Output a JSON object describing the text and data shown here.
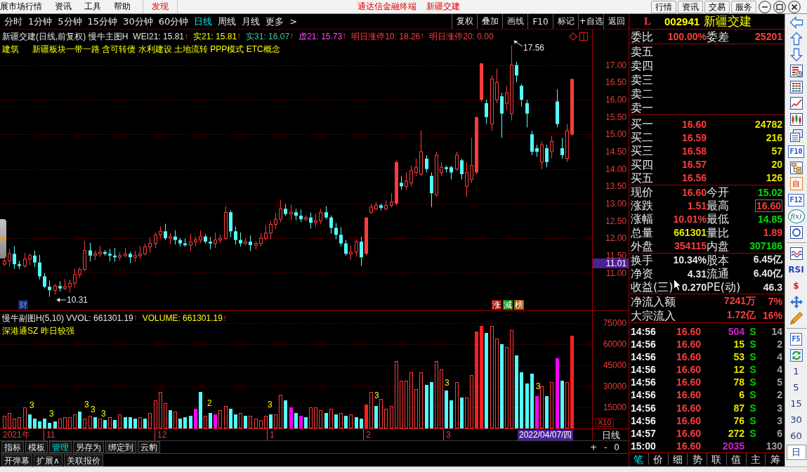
{
  "title_bar": {
    "menu": [
      {
        "label": "展市场行情",
        "emphasized": false
      },
      {
        "label": "资讯",
        "emphasized": false
      },
      {
        "label": "工具",
        "emphasized": false
      },
      {
        "label": "帮助",
        "emphasized": false
      },
      {
        "label": "发现",
        "emphasized": true
      }
    ],
    "app_title": "通达信金融终端",
    "stock_title": "新疆交建",
    "buttons": [
      "行情",
      "资讯",
      "交易",
      "服务"
    ]
  },
  "period_bar": {
    "periods": [
      {
        "label": "分时",
        "selected": false
      },
      {
        "label": "1分钟",
        "selected": false
      },
      {
        "label": "5分钟",
        "selected": false
      },
      {
        "label": "15分钟",
        "selected": false
      },
      {
        "label": "30分钟",
        "selected": false
      },
      {
        "label": "60分钟",
        "selected": false
      },
      {
        "label": "日线",
        "selected": true
      },
      {
        "label": "周线",
        "selected": false
      },
      {
        "label": "月线",
        "selected": false
      },
      {
        "label": "更多",
        "selected": false
      }
    ],
    "more_arrow": ">",
    "actions": [
      "复权",
      "叠加",
      "画线",
      "F10",
      "标记",
      "+自选",
      "返回"
    ]
  },
  "main_chart": {
    "legend": [
      {
        "text": "新疆交建(日线,前复权) 慢牛主图H",
        "color": "#e6e6e6"
      },
      {
        "text": "WEI21: 15.81",
        "color": "#e6e6e6",
        "trend": "↑"
      },
      {
        "text": "实21: 15.81",
        "color": "#ffff00",
        "trend": "↑"
      },
      {
        "text": "实31: 16.07",
        "color": "#3cc8a0",
        "trend": "↑"
      },
      {
        "text": "虚21: 15.73",
        "color": "#ff40ff",
        "trend": "↑"
      },
      {
        "text": "明日涨停10: 18.26",
        "color": "#ff3c3c",
        "trend": "↑"
      },
      {
        "text": "明日涨停20: 0.00",
        "color": "#ff3c3c"
      }
    ],
    "sector": "建筑",
    "concepts": "新疆板块一带一路 含可转债 水利建设 土地流转 PPP模式 ETC概念",
    "price_ticks": [
      "17.00",
      "16.50",
      "16.00",
      "15.50",
      "15.00",
      "14.50",
      "14.00",
      "13.50",
      "13.00",
      "12.50",
      "12.00",
      "11.50",
      "11.00"
    ],
    "cursor_price": "11.01",
    "high_label": "17.56",
    "low_label": "10.31",
    "finance_badge": "财",
    "badges": [
      {
        "text": "涨",
        "color": "#a01010"
      },
      {
        "text": "減",
        "color": "#108a10"
      },
      {
        "text": "榜",
        "color": "#a05a10"
      }
    ]
  },
  "volume_chart": {
    "legend": [
      {
        "text": "慢牛副图H(5,10) VVOL: 661301.19",
        "color": "#e6e6e6",
        "trend": "↑"
      },
      {
        "text": "VOLUME: 661301.19",
        "color": "#ffff00",
        "trend": "↑"
      }
    ],
    "note": "深港通SZ 昨日较强",
    "volume_ticks": [
      "75000",
      "60000",
      "45000",
      "30000",
      "15000"
    ],
    "scale": "X10",
    "markers": [
      "3",
      "3",
      "3",
      "3",
      "3",
      "2",
      "3",
      "3",
      "3",
      "3"
    ]
  },
  "date_axis": {
    "labels": [
      "2021年",
      "11",
      "12",
      "1",
      "2",
      "3"
    ],
    "cursor_date": "2022/04/07/四",
    "period": "日线"
  },
  "bottom_tabs": [
    {
      "label": "指标",
      "selected": false
    },
    {
      "label": "模板",
      "selected": false
    },
    {
      "label": "管理",
      "selected": true
    },
    {
      "label": "另存为",
      "selected": false
    },
    {
      "label": "绑定到",
      "selected": false
    },
    {
      "label": "云豹",
      "selected": false
    }
  ],
  "zoom_controls": [
    "+",
    "-",
    "0"
  ],
  "extension_tabs": [
    "开弹幕",
    "扩展∧",
    "关联报价"
  ],
  "quote": {
    "market_flag": "L",
    "code": "002941",
    "name": "新疆交建",
    "ratio": [
      {
        "label": "委比",
        "value": "100.00%"
      },
      {
        "label": "委差",
        "value": "25201"
      }
    ],
    "asks": [
      "卖五",
      "卖四",
      "卖三",
      "卖二",
      "卖一"
    ],
    "bids": [
      {
        "label": "买一",
        "price": "16.60",
        "volume": "24782"
      },
      {
        "label": "买二",
        "price": "16.59",
        "volume": "216"
      },
      {
        "label": "买三",
        "price": "16.58",
        "volume": "57"
      },
      {
        "label": "买四",
        "price": "16.57",
        "volume": "20"
      },
      {
        "label": "买五",
        "price": "16.56",
        "volume": "126"
      }
    ],
    "stats": [
      {
        "label": "现价",
        "value": "16.60",
        "color": "#ff3c3c",
        "highlighted": false
      },
      {
        "label": "今开",
        "value": "15.02",
        "color": "#00e000",
        "highlighted": false
      },
      {
        "label": "涨跌",
        "value": "1.51",
        "color": "#ff3c3c",
        "highlighted": false
      },
      {
        "label": "最高",
        "value": "16.60",
        "color": "#ff3c3c",
        "highlighted": true
      },
      {
        "label": "涨幅",
        "value": "10.01%",
        "color": "#ff3c3c",
        "highlighted": false
      },
      {
        "label": "最低",
        "value": "14.85",
        "color": "#00e000",
        "highlighted": false
      },
      {
        "label": "总量",
        "value": "661301",
        "color": "#e6e600",
        "highlighted": false
      },
      {
        "label": "量比",
        "value": "1.89",
        "color": "#ff3c3c",
        "highlighted": false
      },
      {
        "label": "外盘",
        "value": "354115",
        "color": "#ff3c3c",
        "highlighted": false
      },
      {
        "label": "内盘",
        "value": "307186",
        "color": "#00e000",
        "highlighted": false
      }
    ],
    "profile": [
      {
        "label": "换手",
        "value": "10.34%"
      },
      {
        "label": "股本",
        "value": "6.45亿"
      },
      {
        "label": "净资",
        "value": "4.31"
      },
      {
        "label": "流通",
        "value": "6.40亿"
      },
      {
        "label": "收益(三)",
        "value": "0.270"
      },
      {
        "label": "PE(动)",
        "value": "46.3"
      }
    ],
    "flows": [
      {
        "label": "净流入额",
        "amount": "7241万",
        "share": "7%"
      },
      {
        "label": "大宗流入",
        "amount": "1.72亿",
        "share": "16%"
      }
    ],
    "ticks": [
      {
        "time": "14:56",
        "price": "16.60",
        "volume": "504",
        "large": true,
        "side": "S",
        "count": "14"
      },
      {
        "time": "14:56",
        "price": "16.60",
        "volume": "15",
        "large": false,
        "side": "S",
        "count": "2"
      },
      {
        "time": "14:56",
        "price": "16.60",
        "volume": "53",
        "large": false,
        "side": "S",
        "count": "4"
      },
      {
        "time": "14:56",
        "price": "16.60",
        "volume": "12",
        "large": false,
        "side": "S",
        "count": "4"
      },
      {
        "time": "14:56",
        "price": "16.60",
        "volume": "78",
        "large": false,
        "side": "S",
        "count": "5"
      },
      {
        "time": "14:56",
        "price": "16.60",
        "volume": "6",
        "large": false,
        "side": "S",
        "count": "2"
      },
      {
        "time": "14:56",
        "price": "16.60",
        "volume": "87",
        "large": false,
        "side": "S",
        "count": "3"
      },
      {
        "time": "14:56",
        "price": "16.60",
        "volume": "76",
        "large": false,
        "side": "S",
        "count": "3"
      },
      {
        "time": "14:57",
        "price": "16.60",
        "volume": "272",
        "large": false,
        "side": "S",
        "count": "6"
      },
      {
        "time": "15:00",
        "price": "16.60",
        "volume": "2035",
        "large": true,
        "count": "130"
      }
    ],
    "tabs": [
      {
        "label": "笔",
        "selected": true
      },
      {
        "label": "价",
        "selected": false
      },
      {
        "label": "细",
        "selected": false
      },
      {
        "label": "势",
        "selected": false
      },
      {
        "label": "联",
        "selected": false
      },
      {
        "label": "值",
        "selected": false
      },
      {
        "label": "主",
        "selected": false
      },
      {
        "label": "筹",
        "selected": false
      }
    ]
  },
  "side_toolbar": [
    {
      "kind": "icon"
    },
    {
      "kind": "icon"
    },
    {
      "kind": "icon"
    },
    {
      "kind": "icon"
    },
    {
      "kind": "icon"
    },
    {
      "kind": "icon"
    },
    {
      "kind": "icon"
    },
    {
      "kind": "icon"
    },
    {
      "kind": "key",
      "label": "F10"
    },
    {
      "kind": "icon"
    },
    {
      "kind": "doc",
      "label": "自"
    },
    {
      "kind": "key",
      "label": "F12"
    },
    {
      "kind": "formula",
      "label": "f(x)"
    },
    {
      "kind": "icon"
    },
    {
      "kind": "icon"
    },
    {
      "kind": "text",
      "label": "RSI",
      "color": "#1848c8"
    },
    {
      "kind": "text",
      "label": "$",
      "color": "#d02020"
    },
    {
      "kind": "icon"
    },
    {
      "kind": "icon"
    },
    {
      "kind": "key",
      "label": "F5"
    },
    {
      "kind": "icon"
    },
    {
      "kind": "period",
      "label": "1",
      "selected": false
    },
    {
      "kind": "period",
      "label": "5",
      "selected": false
    },
    {
      "kind": "period",
      "label": "15",
      "selected": false
    },
    {
      "kind": "period",
      "label": "30",
      "selected": false
    },
    {
      "kind": "period",
      "label": "60",
      "selected": false
    },
    {
      "kind": "period",
      "label": "日",
      "selected": true
    }
  ]
}
